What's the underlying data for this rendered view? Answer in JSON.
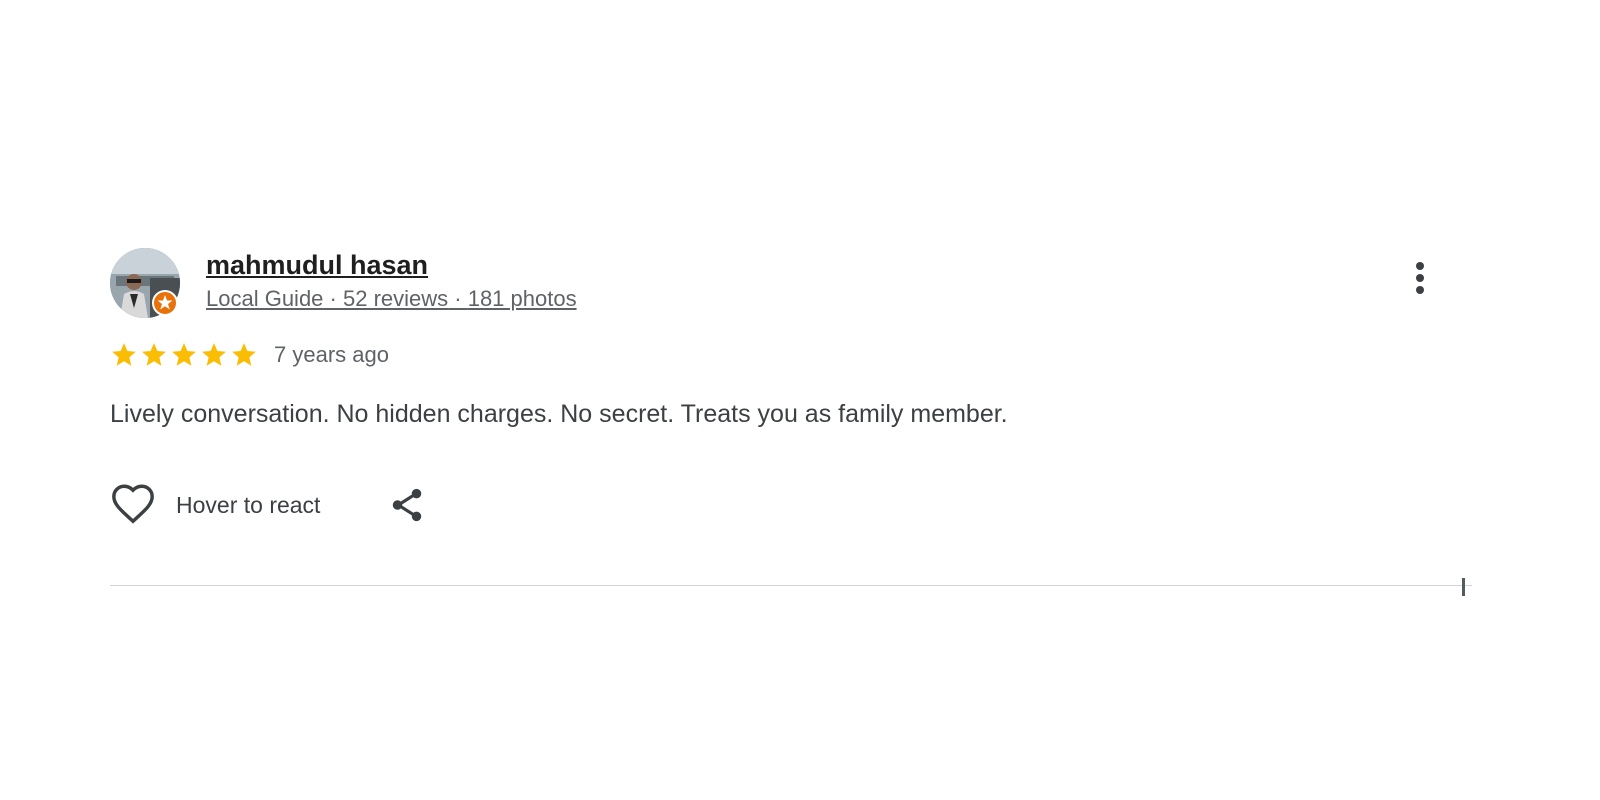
{
  "review": {
    "reviewer": {
      "name": "mahmudul hasan",
      "badge": "Local Guide",
      "separator_1": " · ",
      "reviews_count": "52 reviews",
      "separator_2": " · ",
      "photos_count": "181 photos",
      "avatar_icon": "user-avatar",
      "badge_icon": "local-guide-star-badge"
    },
    "rating": {
      "stars": 5,
      "max_stars": 5,
      "star_color": "#fbbc04"
    },
    "date": "7 years ago",
    "text": "Lively conversation. No hidden charges. No secret. Treats you as family member.",
    "actions": {
      "react_label": "Hover to react",
      "react_icon": "heart-icon",
      "share_icon": "share-icon",
      "more_icon": "more-vert-icon"
    }
  },
  "colors": {
    "name_text": "#1f1f1f",
    "meta_text": "#5f6368",
    "body_text": "#3c4043",
    "badge_orange": "#e8710a",
    "divider": "#d0d4d8"
  }
}
